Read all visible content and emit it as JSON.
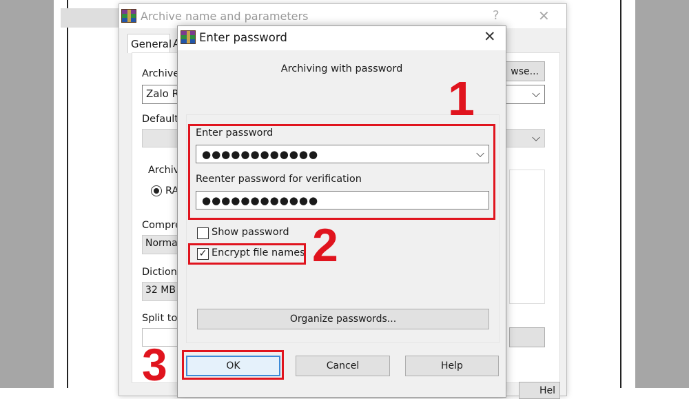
{
  "back_dialog": {
    "title": "Archive name and parameters",
    "help_glyph": "?",
    "close_glyph": "✕",
    "tab_general": "General",
    "tab_partial": "A",
    "archive_label": "Archive",
    "archive_value": "Zalo R",
    "browse_partial": "wse...",
    "default_label": "Default",
    "format_label": "Archiv",
    "format_radio": "RA",
    "compression_label": "Compre",
    "compression_value": "Norma",
    "dictionary_label": "Dictiona",
    "dictionary_value": "32 MB",
    "split_label": "Split to",
    "help_partial": "Hel"
  },
  "dialog": {
    "title": "Enter password",
    "close_glyph": "✕",
    "heading": "Archiving with password",
    "enter_password_label": "Enter password",
    "password_value": "●●●●●●●●●●●●",
    "reenter_label": "Reenter password for verification",
    "reenter_value": "●●●●●●●●●●●●",
    "show_password_label": "Show password",
    "show_password_checked": false,
    "encrypt_names_label": "Encrypt file names",
    "encrypt_names_checked": true,
    "check_glyph": "✓",
    "organize_button": "Organize passwords...",
    "ok_button": "OK",
    "cancel_button": "Cancel",
    "help_button": "Help"
  },
  "annotations": {
    "step1": "1",
    "step2": "2",
    "step3": "3",
    "color": "#e0141e"
  }
}
